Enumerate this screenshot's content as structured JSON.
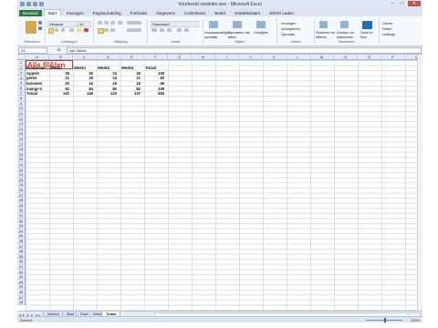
{
  "window": {
    "title": "Voorbeeld verdelen.xlsx - Microsoft Excel"
  },
  "tabs": [
    "Bestand",
    "Start",
    "Invoegen",
    "Pagina-indeling",
    "Formules",
    "Gegevens",
    "Controleren",
    "Beeld",
    "Ontwikkelaars",
    "ZOHO Laden"
  ],
  "ribbon": {
    "groups": [
      "Klembord",
      "Lettertype",
      "Uitlijning",
      "Getal",
      "Stijlen",
      "Cellen",
      "Bewerken"
    ],
    "font_name": "Verdana",
    "font_size": "10",
    "number_format": "Standaard",
    "styles": [
      "Voorwaardelijke opmaak",
      "Opmaken als tabel",
      "Celstijlen"
    ],
    "cells": [
      "Invoegen",
      "Verwijderen",
      "Opmaak"
    ],
    "edit": [
      "Sorteren en filteren",
      "Zoeken en selecteren",
      "Save to Box"
    ],
    "right": [
      "Clever",
      "Delen",
      "Lettings"
    ]
  },
  "formula_bar": {
    "name_box": "A1",
    "fx": "fx",
    "value": "Alle fil&ten"
  },
  "columns": [
    "A",
    "B",
    "C",
    "D",
    "E",
    "F",
    "G",
    "H",
    "I",
    "J",
    "K",
    "L",
    "M",
    "N",
    "O",
    "P",
    "Q"
  ],
  "rows": [
    "1",
    "2",
    "3",
    "4",
    "5",
    "6",
    "7",
    "8",
    "9",
    "10",
    "11",
    "12",
    "13",
    "14",
    "15",
    "16",
    "17",
    "18",
    "19",
    "20",
    "21",
    "22",
    "23",
    "24",
    "25",
    "26",
    "27",
    "28",
    "29",
    "30",
    "31",
    "32",
    "33",
    "34",
    "35",
    "36",
    "37",
    "38",
    "39",
    "40",
    "41",
    "42",
    "43",
    "44",
    "45",
    "46",
    "47",
    "48"
  ],
  "a1": "Alle fil&len",
  "table": {
    "headers": [
      "Producten",
      "Week1",
      "Week1",
      "Week2",
      "Week4",
      "Totaal"
    ],
    "rows": [
      [
        "Appels",
        "29",
        "30",
        "23",
        "26",
        "108"
      ],
      [
        "peren",
        "21",
        "18",
        "24",
        "21",
        "82"
      ],
      [
        "bananen",
        "20",
        "16",
        "16",
        "18",
        "68"
      ],
      [
        "mango's",
        "92",
        "84",
        "80",
        "82",
        "338"
      ],
      [
        "Totaal",
        "162",
        "146",
        "143",
        "147",
        "594"
      ]
    ]
  },
  "sheet_tabs": [
    "Wereld",
    "Blad",
    "Zuid",
    "West",
    "Totaal"
  ],
  "active_sheet": "Totaal",
  "status": {
    "ready": "Gereed",
    "zoom": "100%"
  }
}
